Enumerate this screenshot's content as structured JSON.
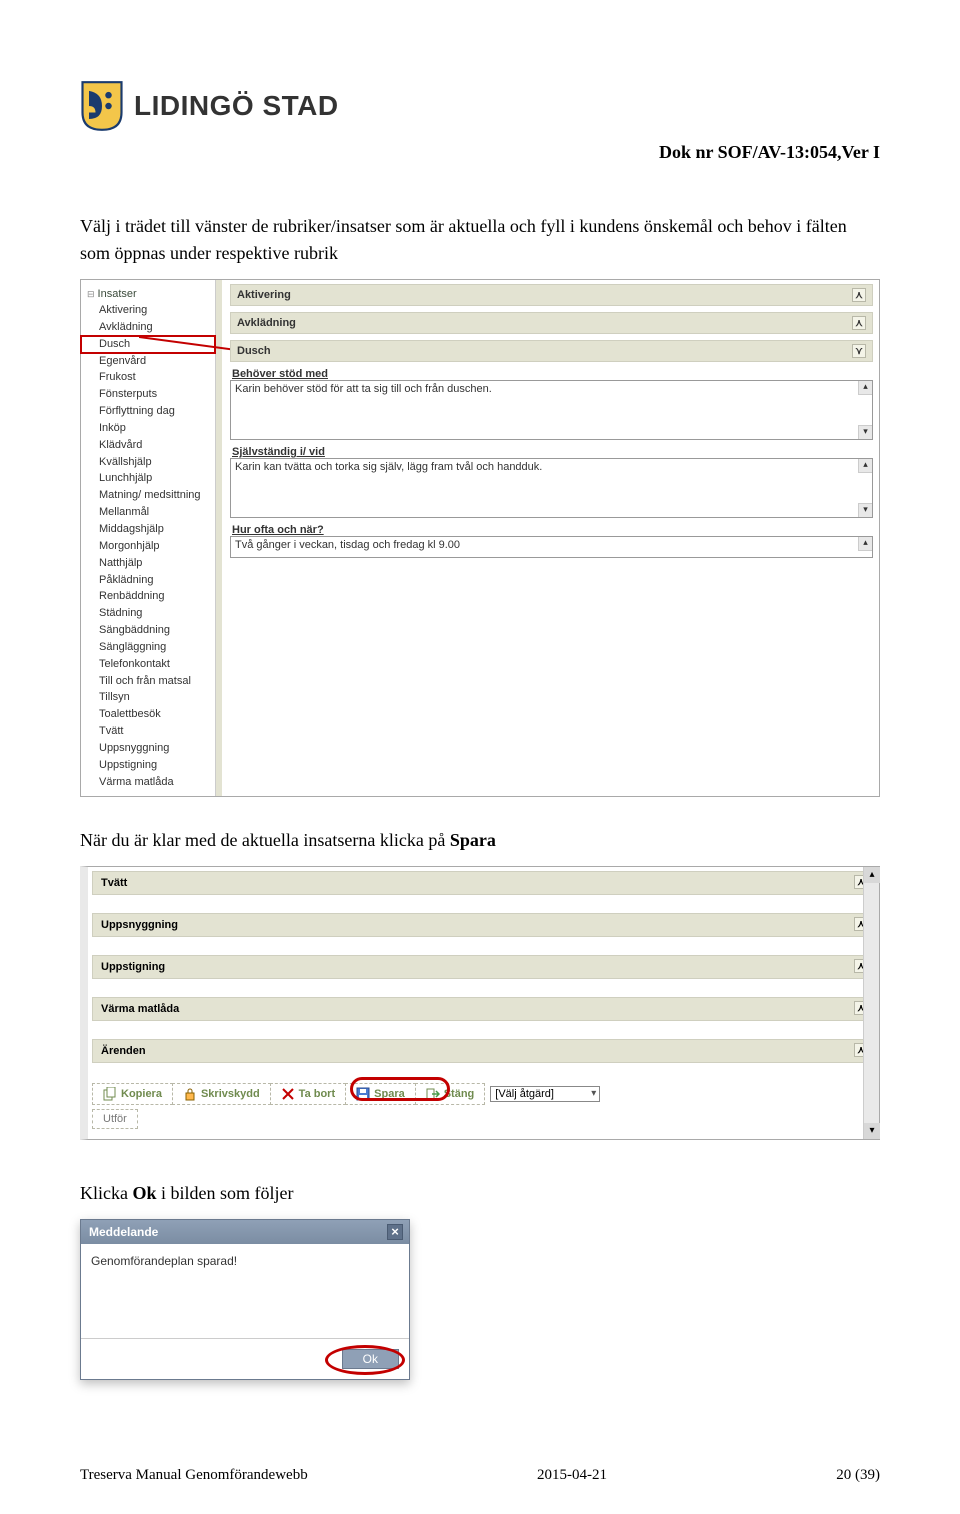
{
  "header": {
    "brand": "LIDINGÖ STAD",
    "doc_ref": "Dok nr SOF/AV-13:054,Ver I"
  },
  "text": {
    "p1": "Välj i trädet till vänster de rubriker/insatser som är aktuella och fyll i kundens önskemål och behov i fälten som öppnas under respektive rubrik",
    "p2_a": "När du är klar med de aktuella insatserna klicka på ",
    "p2_b": "Spara",
    "p3_a": "Klicka ",
    "p3_b": "Ok",
    "p3_c": " i bilden som följer"
  },
  "shot1": {
    "tree_header": "Insatser",
    "tree_items": [
      "Aktivering",
      "Avklädning",
      "Dusch",
      "Egenvård",
      "Frukost",
      "Fönsterputs",
      "Förflyttning dag",
      "Inköp",
      "Klädvård",
      "Kvällshjälp",
      "Lunchhjälp",
      "Matning/ medsittning",
      "Mellanmål",
      "Middagshjälp",
      "Morgonhjälp",
      "Natthjälp",
      "Påklädning",
      "Renbäddning",
      "Städning",
      "Sängbäddning",
      "Sängläggning",
      "Telefonkontakt",
      "Till och från matsal",
      "Tillsyn",
      "Toalettbesök",
      "Tvätt",
      "Uppsnyggning",
      "Uppstigning",
      "Värma matlåda"
    ],
    "selected_index": 2,
    "sections": {
      "aktivering": "Aktivering",
      "avkladning": "Avklädning",
      "dusch": "Dusch",
      "behover_label": "Behöver stöd med",
      "behover_value": "Karin behöver stöd för att ta sig till och från duschen.",
      "sjalvstandig_label": "Självständig i/ vid",
      "sjalvstandig_value": "Karin kan tvätta och torka sig själv, lägg fram tvål och handduk.",
      "hurofta_label": "Hur ofta och när?",
      "hurofta_value": "Två gånger i veckan, tisdag och fredag kl 9.00"
    }
  },
  "shot2": {
    "sections": [
      "Tvätt",
      "Uppsnyggning",
      "Uppstigning",
      "Värma matlåda",
      "Ärenden"
    ],
    "toolbar": {
      "kopiera": "Kopiera",
      "skrivskydd": "Skrivskydd",
      "tabort": "Ta bort",
      "spara": "Spara",
      "stang": "Stäng",
      "select": "[Välj åtgärd]",
      "utfor": "Utför"
    }
  },
  "dialog": {
    "title": "Meddelande",
    "body": "Genomförandeplan sparad!",
    "ok": "Ok"
  },
  "footer": {
    "left": "Treserva Manual Genomförandewebb",
    "center": "2015-04-21",
    "right": "20 (39)"
  }
}
